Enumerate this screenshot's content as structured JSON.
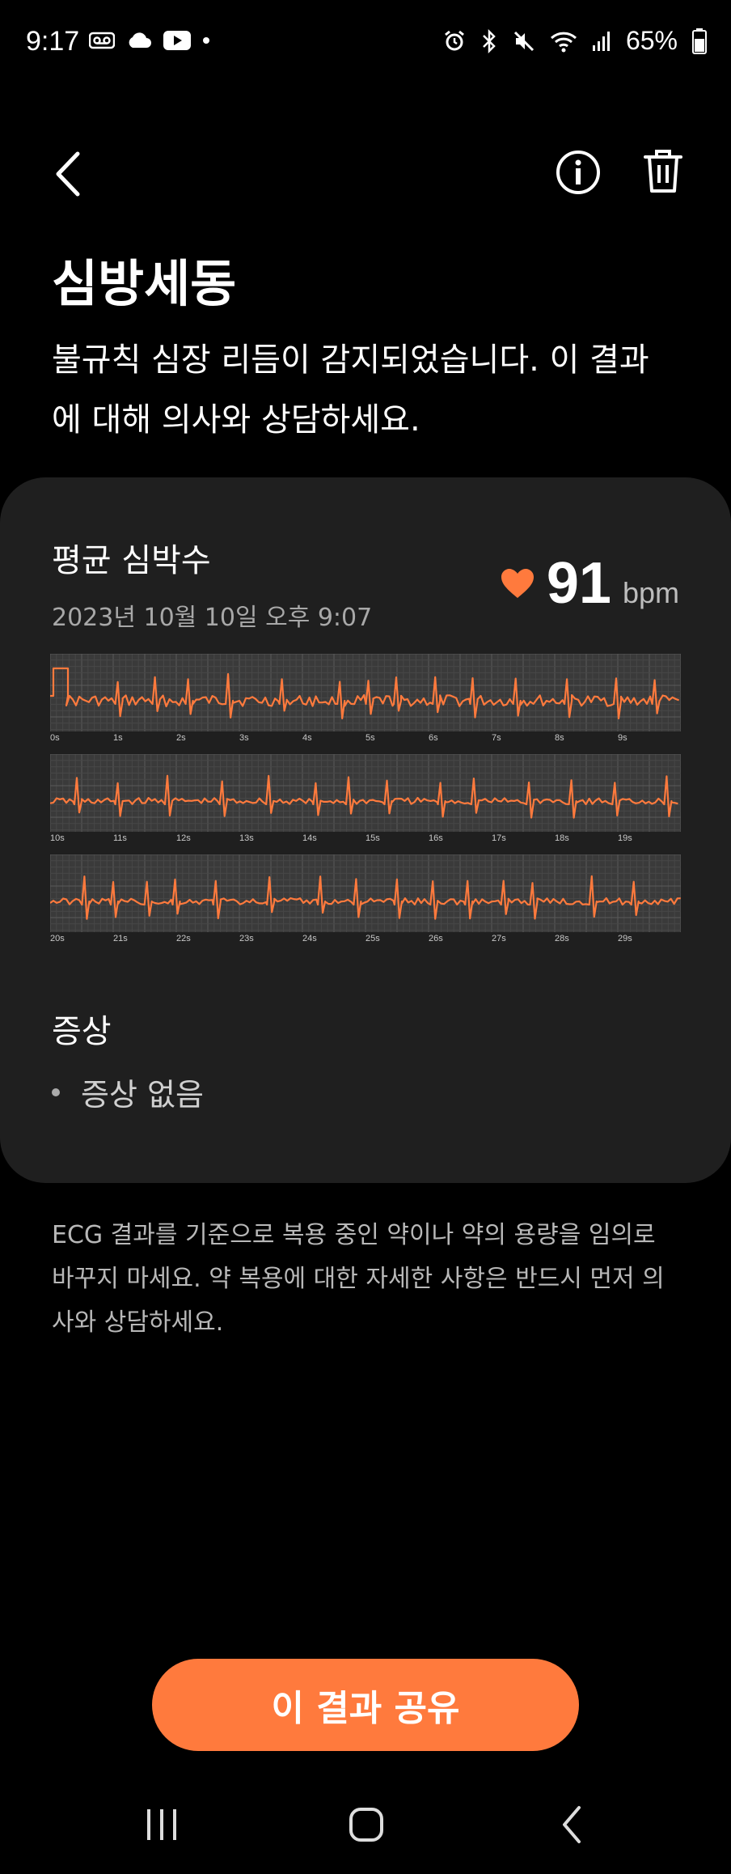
{
  "status_bar": {
    "time": "9:17",
    "battery": "65%"
  },
  "header": {
    "title": "심방세동",
    "description": "불규칙 심장 리듬이 감지되었습니다. 이 결과에 대해 의사와 상담하세요."
  },
  "card": {
    "heart_rate_label": "평균 심박수",
    "date": "2023년 10월 10일 오후 9:07",
    "heart_rate_value": "91",
    "heart_rate_unit": "bpm",
    "ecg_rows": [
      {
        "ticks": [
          "0s",
          "1s",
          "2s",
          "3s",
          "4s",
          "5s",
          "6s",
          "7s",
          "8s",
          "9s"
        ]
      },
      {
        "ticks": [
          "10s",
          "11s",
          "12s",
          "13s",
          "14s",
          "15s",
          "16s",
          "17s",
          "18s",
          "19s"
        ]
      },
      {
        "ticks": [
          "20s",
          "21s",
          "22s",
          "23s",
          "24s",
          "25s",
          "26s",
          "27s",
          "28s",
          "29s"
        ]
      }
    ],
    "symptoms_title": "증상",
    "symptoms": [
      "증상 없음"
    ]
  },
  "disclaimer": "ECG 결과를 기준으로 복용 중인 약이나 약의 용량을 임의로 바꾸지 마세요. 약 복용에 대한 자세한 사항은 반드시 먼저 의사와 상담하세요.",
  "share_button_label": "이 결과 공유",
  "colors": {
    "accent": "#ff7a3d",
    "card_bg": "#1f1f1f",
    "ecg_line": "#ff7a3d",
    "ecg_bg": "#3a3a3a"
  },
  "icons": [
    "voicemail-icon",
    "cloud-icon",
    "youtube-icon",
    "alarm-icon",
    "bluetooth-icon",
    "mute-icon",
    "wifi-icon",
    "signal-icon",
    "battery-icon",
    "back-arrow-icon",
    "info-icon",
    "trash-icon",
    "heart-icon",
    "recents-icon",
    "home-icon",
    "nav-back-icon"
  ]
}
